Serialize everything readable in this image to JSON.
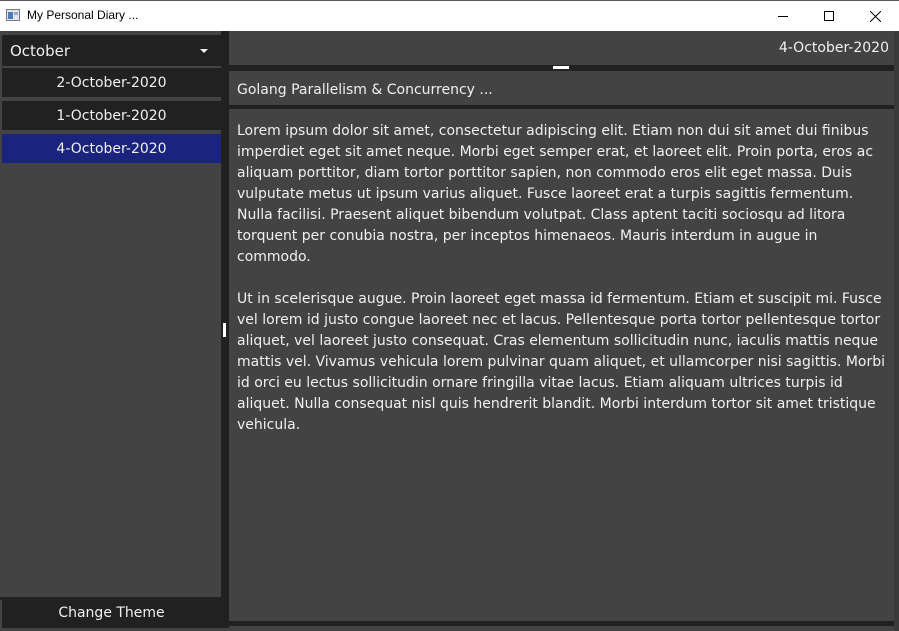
{
  "window": {
    "title": "My Personal Diary ...",
    "icon": "app-icon",
    "controls": {
      "minimize": "minimize-icon",
      "maximize": "maximize-icon",
      "close": "close-icon"
    }
  },
  "sidebar": {
    "month_select": {
      "value": "October",
      "icon": "chevron-down-icon"
    },
    "entries": [
      {
        "label": "2-October-2020",
        "selected": false
      },
      {
        "label": "1-October-2020",
        "selected": false
      },
      {
        "label": "4-October-2020",
        "selected": true
      }
    ],
    "change_theme_label": "Change Theme"
  },
  "main": {
    "date": "4-October-2020",
    "entry_title": "Golang Parallelism & Concurrency ...",
    "entry_body": "Lorem ipsum dolor sit amet, consectetur adipiscing elit. Etiam non dui sit amet dui finibus imperdiet eget sit amet neque. Morbi eget semper erat, et laoreet elit. Proin porta, eros ac aliquam porttitor, diam tortor porttitor sapien, non commodo eros elit eget massa. Duis vulputate metus ut ipsum varius aliquet. Fusce laoreet erat a turpis sagittis fermentum. Nulla facilisi. Praesent aliquet bibendum volutpat. Class aptent taciti sociosqu ad litora torquent per conubia nostra, per inceptos himenaeos. Mauris interdum in augue in commodo.\n\nUt in scelerisque augue. Proin laoreet eget massa id fermentum. Etiam et suscipit mi. Fusce vel lorem id justo congue laoreet nec et lacus. Pellentesque porta tortor pellentesque tortor aliquet, vel laoreet justo consequat. Cras elementum sollicitudin nunc, iaculis mattis neque mattis vel. Vivamus vehicula lorem pulvinar quam aliquet, et ullamcorper nisi sagittis. Morbi id orci eu lectus sollicitudin ornare fringilla vitae lacus. Etiam aliquam ultrices turpis id aliquet. Nulla consequat nisl quis hendrerit blandit. Morbi interdum tortor sit amet tristique vehicula."
  },
  "colors": {
    "background": "#434343",
    "panel_dark": "#212121",
    "selected": "#1a237e",
    "text": "#f0f0f0"
  }
}
